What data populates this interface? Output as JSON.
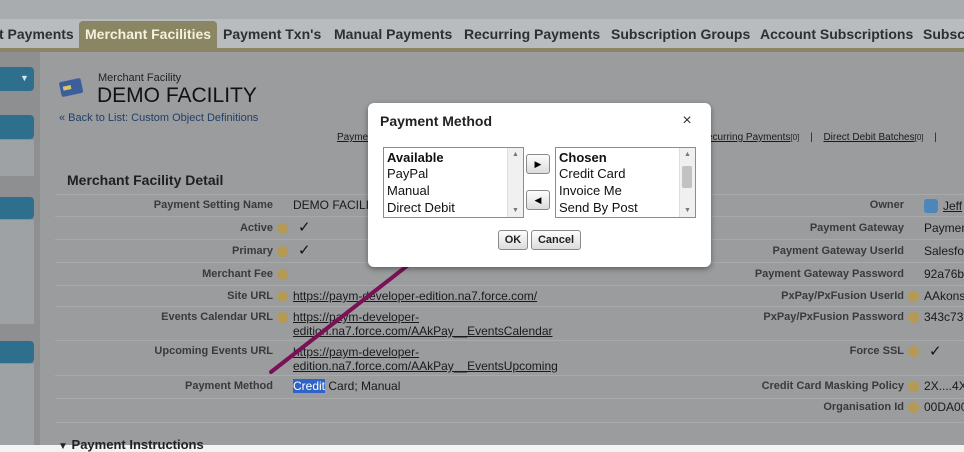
{
  "tabs": [
    "t Payments",
    "Merchant Facilities",
    "Payment Txn's",
    "Manual Payments",
    "Recurring Payments",
    "Subscription Groups",
    "Account Subscriptions",
    "Subscr"
  ],
  "header": {
    "object_label": "Merchant Facility",
    "title": "DEMO FACILITY",
    "back_link": "« Back to List: Custom Object Definitions",
    "related_left": "Payme",
    "related_links": [
      "ecurring Payments",
      "[0]",
      "|",
      "Direct Debit Batches",
      "[0]",
      "|"
    ]
  },
  "detail": {
    "section_title": "Merchant Facility Detail",
    "left": [
      {
        "label": "Payment Setting Name",
        "value": "DEMO FACILI"
      },
      {
        "label": "Active",
        "value": "✓"
      },
      {
        "label": "Primary",
        "value": "✓"
      },
      {
        "label": "Merchant Fee",
        "value": ""
      },
      {
        "label": "Site URL",
        "value": "https://paym-developer-edition.na7.force.com/"
      },
      {
        "label": "Events Calendar URL",
        "value": "https://paym-developer-",
        "value2": "edition.na7.force.com/AAkPay__EventsCalendar"
      },
      {
        "label": "Upcoming Events URL",
        "value": "https://paym-developer-",
        "value2": "edition.na7.force.com/AAkPay__EventsUpcoming"
      },
      {
        "label": "Payment Method",
        "highlight": "Credit",
        "value": " Card; Manual"
      }
    ],
    "right": [
      {
        "label": "Owner",
        "value": "Jeff"
      },
      {
        "label": "Payment Gateway",
        "value": "Paymen"
      },
      {
        "label": "Payment Gateway UserId",
        "value": "Salesfo"
      },
      {
        "label": "Payment Gateway Password",
        "value": "92a76b"
      },
      {
        "label": "PxPay/PxFusion UserId",
        "value": "AAkons"
      },
      {
        "label": "PxPay/PxFusion Password",
        "value": "343c73"
      },
      {
        "label": "Force SSL",
        "value": "✓"
      },
      {
        "label": "Credit Card Masking Policy",
        "value": "2X....4X"
      },
      {
        "label": "Organisation Id",
        "value": "00DA00"
      }
    ],
    "next_section": "Payment Instructions"
  },
  "dialog": {
    "title": "Payment Method",
    "close": "×",
    "available_header": "Available",
    "available": [
      "PayPal",
      "Manual",
      "Direct Debit"
    ],
    "chosen_header": "Chosen",
    "chosen": [
      "Credit Card",
      "Invoice Me",
      "Send By Post"
    ],
    "add_arrow": "▶",
    "remove_arrow": "◀",
    "ok_label": "OK",
    "cancel_label": "Cancel"
  },
  "colors": {
    "arrow_annotation": "#7a1055",
    "active_tab": "#8a8663",
    "sidebar_accent": "#2d6f8c"
  }
}
